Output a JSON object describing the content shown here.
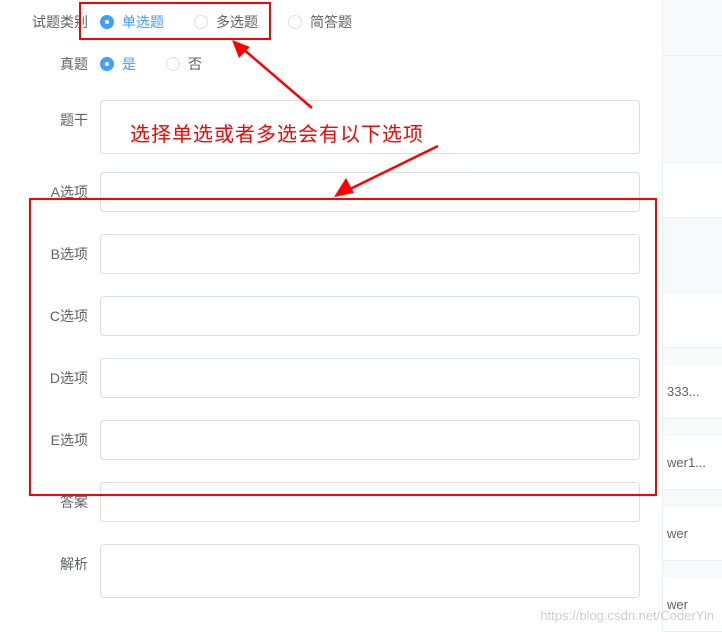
{
  "labels": {
    "question_type": "试题类别",
    "is_real": "真题",
    "stem": "题干",
    "optA": "A选项",
    "optB": "B选项",
    "optC": "C选项",
    "optD": "D选项",
    "optE": "E选项",
    "answer": "答案",
    "analysis": "解析"
  },
  "question_type": {
    "options": [
      {
        "label": "单选题",
        "checked": true
      },
      {
        "label": "多选题",
        "checked": false
      },
      {
        "label": "简答题",
        "checked": false
      }
    ]
  },
  "is_real": {
    "options": [
      {
        "label": "是",
        "checked": true
      },
      {
        "label": "否",
        "checked": false
      }
    ]
  },
  "inputs": {
    "stem": "",
    "optA": "",
    "optB": "",
    "optC": "",
    "optD": "",
    "optE": "",
    "answer": "",
    "analysis": ""
  },
  "annotation": {
    "text": "选择单选或者多选会有以下选项"
  },
  "bg_rows": {
    "r3": "333...",
    "r4": "wer1...",
    "r5": "wer",
    "r6": "wer"
  },
  "watermark": "https://blog.csdn.net/CoderYin"
}
